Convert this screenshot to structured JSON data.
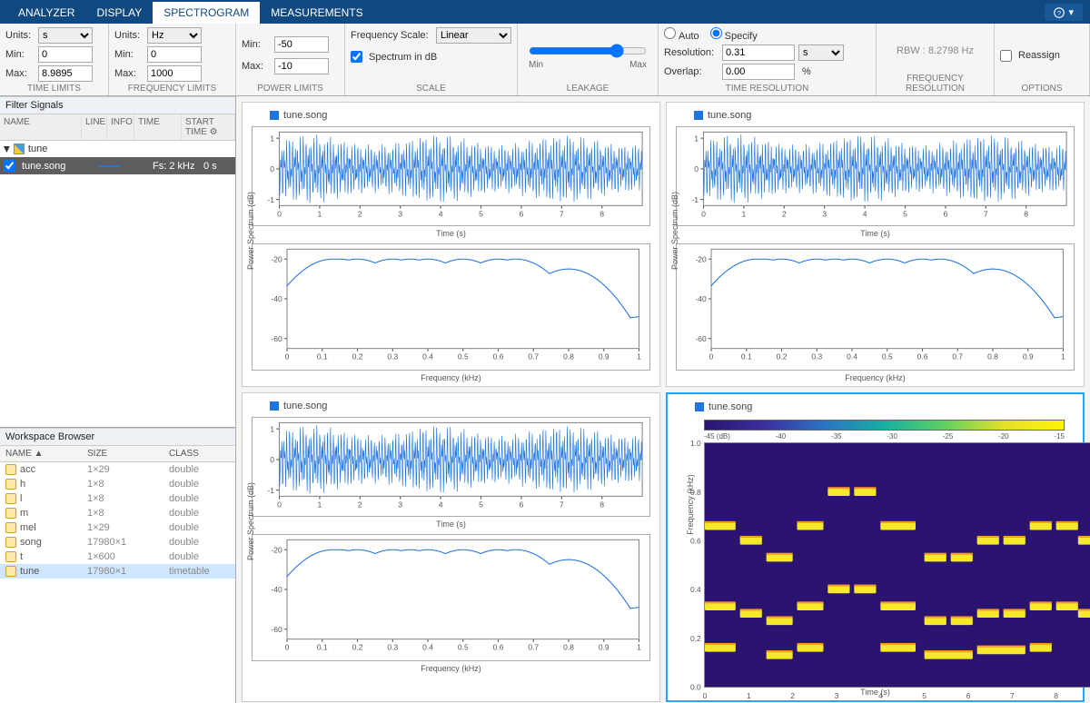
{
  "tabs": {
    "analyzer": "ANALYZER",
    "display": "DISPLAY",
    "spectrogram": "SPECTROGRAM",
    "measurements": "MEASUREMENTS",
    "active": "spectrogram"
  },
  "timeLimits": {
    "label": "TIME LIMITS",
    "unitsLabel": "Units:",
    "units": "s",
    "minLabel": "Min:",
    "min": "0",
    "maxLabel": "Max:",
    "max": "8.9895"
  },
  "freqLimits": {
    "label": "FREQUENCY LIMITS",
    "unitsLabel": "Units:",
    "units": "Hz",
    "minLabel": "Min:",
    "min": "0",
    "maxLabel": "Max:",
    "max": "1000"
  },
  "powerLimits": {
    "label": "POWER LIMITS",
    "minLabel": "Min:",
    "min": "-50",
    "maxLabel": "Max:",
    "max": "-10"
  },
  "scale": {
    "label": "SCALE",
    "freqScaleLabel": "Frequency Scale:",
    "freqScale": "Linear",
    "specDbLabel": "Spectrum in dB",
    "specDb": true
  },
  "leakage": {
    "label": "LEAKAGE",
    "value": 78,
    "minLabel": "Min",
    "maxLabel": "Max"
  },
  "timeRes": {
    "label": "TIME RESOLUTION",
    "auto": "Auto",
    "specify": "Specify",
    "mode": "specify",
    "resLabel": "Resolution:",
    "res": "0.31",
    "resUnit": "s",
    "overlapLabel": "Overlap:",
    "overlap": "0.00",
    "overlapUnit": "%"
  },
  "freqRes": {
    "label": "FREQUENCY RESOLUTION",
    "rbw": "RBW : 8.2798 Hz"
  },
  "options": {
    "label": "OPTIONS",
    "reassign": "Reassign",
    "reassignChecked": false
  },
  "filterHeader": "Filter Signals",
  "filterCols": {
    "name": "NAME",
    "line": "LINE",
    "info": "INFO",
    "time": "TIME",
    "start": "START TIME"
  },
  "signalGroup": "tune",
  "signal": {
    "name": "tune.song",
    "fs": "Fs: 2 kHz",
    "start": "0 s"
  },
  "wsHeader": "Workspace Browser",
  "wsCols": {
    "name": "NAME ▲",
    "size": "SIZE",
    "class": "CLASS"
  },
  "wsVars": [
    {
      "name": "acc",
      "size": "1×29",
      "class": "double"
    },
    {
      "name": "h",
      "size": "1×8",
      "class": "double"
    },
    {
      "name": "l",
      "size": "1×8",
      "class": "double"
    },
    {
      "name": "m",
      "size": "1×8",
      "class": "double"
    },
    {
      "name": "mel",
      "size": "1×29",
      "class": "double"
    },
    {
      "name": "song",
      "size": "17980×1",
      "class": "double"
    },
    {
      "name": "t",
      "size": "1×600",
      "class": "double"
    },
    {
      "name": "tune",
      "size": "17980×1",
      "class": "timetable"
    }
  ],
  "chart_data": [
    {
      "type": "line",
      "panel": "TL-time",
      "title": "tune.song",
      "xlabel": "Time (s)",
      "ylabel": "",
      "xlim": [
        0,
        9
      ],
      "xticks": [
        0,
        1,
        2,
        3,
        4,
        5,
        6,
        7,
        8
      ],
      "ylim": [
        -1.2,
        1.2
      ],
      "yticks": [
        -1,
        0,
        1
      ],
      "series": [
        {
          "name": "tune.song",
          "note": "dense audio waveform oscillating roughly ±1 across 0–9 s"
        }
      ]
    },
    {
      "type": "line",
      "panel": "TL-spectrum",
      "title": "",
      "xlabel": "Frequency (kHz)",
      "ylabel": "Power Spectrum (dB)",
      "xlim": [
        0,
        1.0
      ],
      "xticks": [
        0,
        0.1,
        0.2,
        0.3,
        0.4,
        0.5,
        0.6,
        0.7,
        0.8,
        0.9,
        1.0
      ],
      "ylim": [
        -65,
        -15
      ],
      "yticks": [
        -60,
        -40,
        -20
      ],
      "series": [
        {
          "name": "tune.song",
          "note": "spectral peaks near 0.13,0.15,0.2,0.3,0.35,0.4,0.5,0.6,0.65,0.8 kHz rising to about -20 dB over a floor around -55 dB"
        }
      ]
    },
    {
      "type": "line",
      "panel": "TR-time",
      "sameAs": "TL-time"
    },
    {
      "type": "line",
      "panel": "TR-spectrum",
      "sameAs": "TL-spectrum"
    },
    {
      "type": "line",
      "panel": "BL-time",
      "sameAs": "TL-time"
    },
    {
      "type": "line",
      "panel": "BL-spectrum",
      "sameAs": "TL-spectrum"
    },
    {
      "type": "heatmap",
      "panel": "BR-spectrogram",
      "title": "tune.song",
      "xlabel": "Time (s)",
      "ylabel": "Frequency (kHz)",
      "xlim": [
        0,
        9
      ],
      "xticks": [
        0,
        1,
        2,
        3,
        4,
        5,
        6,
        7,
        8
      ],
      "ylim": [
        0,
        1.0
      ],
      "yticks": [
        0.0,
        0.2,
        0.4,
        0.6,
        0.8,
        1.0
      ],
      "colorbar": {
        "min": -48,
        "max": -12,
        "ticks": [
          -45,
          -40,
          -35,
          -30,
          -25,
          -20,
          -15
        ],
        "ticklabel": "-45 (dB)"
      },
      "note": "sparse horizontal note bands (melody) at discrete frequencies over time"
    }
  ]
}
